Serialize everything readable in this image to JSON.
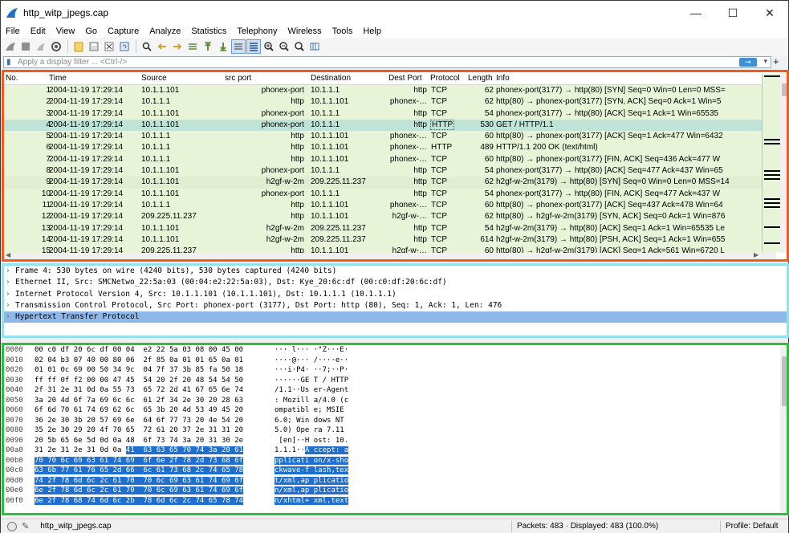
{
  "window": {
    "title": "http_witp_jpegs.cap"
  },
  "menu": [
    "File",
    "Edit",
    "View",
    "Go",
    "Capture",
    "Analyze",
    "Statistics",
    "Telephony",
    "Wireless",
    "Tools",
    "Help"
  ],
  "toolbar_icons": [
    "shark-start-icon",
    "stop-icon",
    "restart-icon",
    "options-icon",
    "open-file-icon",
    "save-file-icon",
    "close-file-icon",
    "reload-icon",
    "find-icon",
    "back-icon",
    "forward-icon",
    "go-to-packet-icon",
    "first-packet-icon",
    "last-packet-icon",
    "autoscroll-icon",
    "colorize-icon",
    "zoom-in-icon",
    "zoom-out-icon",
    "zoom-normal-icon",
    "resize-columns-icon"
  ],
  "filter": {
    "placeholder": "Apply a display filter ... <Ctrl-/>",
    "value": ""
  },
  "columns": [
    "No.",
    "Time",
    "Source",
    "src port",
    "Destination",
    "Dest Port",
    "Protocol",
    "Length",
    "Info"
  ],
  "packets": [
    {
      "no": "1",
      "time": "2004-11-19 17:29:14",
      "src": "10.1.1.101",
      "sport": "phonex-port",
      "dst": "10.1.1.1",
      "dport": "http",
      "proto": "TCP",
      "len": "62",
      "info": "phonex-port(3177) → http(80) [SYN] Seq=0 Win=0 Len=0 MSS="
    },
    {
      "no": "2",
      "time": "2004-11-19 17:29:14",
      "src": "10.1.1.1",
      "sport": "http",
      "dst": "10.1.1.101",
      "dport": "phonex-…",
      "proto": "TCP",
      "len": "62",
      "info": "http(80) → phonex-port(3177) [SYN, ACK] Seq=0 Ack=1 Win=5"
    },
    {
      "no": "3",
      "time": "2004-11-19 17:29:14",
      "src": "10.1.1.101",
      "sport": "phonex-port",
      "dst": "10.1.1.1",
      "dport": "http",
      "proto": "TCP",
      "len": "54",
      "info": "phonex-port(3177) → http(80) [ACK] Seq=1 Ack=1 Win=65535"
    },
    {
      "no": "4",
      "time": "2004-11-19 17:29:14",
      "src": "10.1.1.101",
      "sport": "phonex-port",
      "dst": "10.1.1.1",
      "dport": "http",
      "proto": "HTTP",
      "len": "530",
      "info": "GET / HTTP/1.1",
      "selected": true
    },
    {
      "no": "5",
      "time": "2004-11-19 17:29:14",
      "src": "10.1.1.1",
      "sport": "http",
      "dst": "10.1.1.101",
      "dport": "phonex-…",
      "proto": "TCP",
      "len": "60",
      "info": "http(80) → phonex-port(3177) [ACK] Seq=1 Ack=477 Win=6432"
    },
    {
      "no": "6",
      "time": "2004-11-19 17:29:14",
      "src": "10.1.1.1",
      "sport": "http",
      "dst": "10.1.1.101",
      "dport": "phonex-…",
      "proto": "HTTP",
      "len": "489",
      "info": "HTTP/1.1 200 OK  (text/html)"
    },
    {
      "no": "7",
      "time": "2004-11-19 17:29:14",
      "src": "10.1.1.1",
      "sport": "http",
      "dst": "10.1.1.101",
      "dport": "phonex-…",
      "proto": "TCP",
      "len": "60",
      "info": "http(80) → phonex-port(3177) [FIN, ACK] Seq=436 Ack=477 W"
    },
    {
      "no": "8",
      "time": "2004-11-19 17:29:14",
      "src": "10.1.1.101",
      "sport": "phonex-port",
      "dst": "10.1.1.1",
      "dport": "http",
      "proto": "TCP",
      "len": "54",
      "info": "phonex-port(3177) → http(80) [ACK] Seq=477 Ack=437 Win=65"
    },
    {
      "no": "9",
      "time": "2004-11-19 17:29:14",
      "src": "10.1.1.101",
      "sport": "h2gf-w-2m",
      "dst": "209.225.11.237",
      "dport": "http",
      "proto": "TCP",
      "len": "62",
      "info": "h2gf-w-2m(3179) → http(80) [SYN] Seq=0 Win=0 Len=0 MSS=14",
      "dim": true
    },
    {
      "no": "10",
      "time": "2004-11-19 17:29:14",
      "src": "10.1.1.101",
      "sport": "phonex-port",
      "dst": "10.1.1.1",
      "dport": "http",
      "proto": "TCP",
      "len": "54",
      "info": "phonex-port(3177) → http(80) [FIN, ACK] Seq=477 Ack=437 W"
    },
    {
      "no": "11",
      "time": "2004-11-19 17:29:14",
      "src": "10.1.1.1",
      "sport": "http",
      "dst": "10.1.1.101",
      "dport": "phonex-…",
      "proto": "TCP",
      "len": "60",
      "info": "http(80) → phonex-port(3177) [ACK] Seq=437 Ack=478 Win=64"
    },
    {
      "no": "12",
      "time": "2004-11-19 17:29:14",
      "src": "209.225.11.237",
      "sport": "http",
      "dst": "10.1.1.101",
      "dport": "h2gf-w-…",
      "proto": "TCP",
      "len": "62",
      "info": "http(80) → h2gf-w-2m(3179) [SYN, ACK] Seq=0 Ack=1 Win=876"
    },
    {
      "no": "13",
      "time": "2004-11-19 17:29:14",
      "src": "10.1.1.101",
      "sport": "h2gf-w-2m",
      "dst": "209.225.11.237",
      "dport": "http",
      "proto": "TCP",
      "len": "54",
      "info": "h2gf-w-2m(3179) → http(80) [ACK] Seq=1 Ack=1 Win=65535 Le"
    },
    {
      "no": "14",
      "time": "2004-11-19 17:29:14",
      "src": "10.1.1.101",
      "sport": "h2gf-w-2m",
      "dst": "209.225.11.237",
      "dport": "http",
      "proto": "TCP",
      "len": "614",
      "info": "h2gf-w-2m(3179) → http(80) [PSH, ACK] Seq=1 Ack=1 Win=655"
    },
    {
      "no": "15",
      "time": "2004-11-19 17:29:14",
      "src": "209.225.11.237",
      "sport": "http",
      "dst": "10.1.1.101",
      "dport": "h2gf-w-…",
      "proto": "TCP",
      "len": "60",
      "info": "http(80) → h2gf-w-2m(3179) [ACK] Seq=1 Ack=561 Win=6720 L"
    }
  ],
  "details": [
    {
      "text": "Frame 4: 530 bytes on wire (4240 bits), 530 bytes captured (4240 bits)"
    },
    {
      "text": "Ethernet II, Src: SMCNetwo_22:5a:03 (00:04:e2:22:5a:03), Dst: Kye_20:6c:df (00:c0:df:20:6c:df)"
    },
    {
      "text": "Internet Protocol Version 4, Src: 10.1.1.101 (10.1.1.101), Dst: 10.1.1.1 (10.1.1.1)"
    },
    {
      "text": "Transmission Control Protocol, Src Port: phonex-port (3177), Dst Port: http (80), Seq: 1, Ack: 1, Len: 476"
    },
    {
      "text": "Hypertext Transfer Protocol",
      "selected": true
    }
  ],
  "hex": [
    {
      "off": "0000",
      "hex": "00 c0 df 20 6c df 00 04  e2 22 5a 03 08 00 45 00",
      "ascii": "··· l··· ·\"Z···E·"
    },
    {
      "off": "0010",
      "hex": "02 04 b3 07 40 00 80 06  2f 85 0a 01 01 65 0a 01",
      "ascii": "····@··· /····e··"
    },
    {
      "off": "0020",
      "hex": "01 01 0c 69 00 50 34 9c  04 7f 37 3b 85 fa 50 18",
      "ascii": "···i·P4· ··7;··P·"
    },
    {
      "off": "0030",
      "hex": "ff ff 0f f2 00 00 47 45  54 20 2f 20 48 54 54 50",
      "ascii": "······GE T / HTTP"
    },
    {
      "off": "0040",
      "hex": "2f 31 2e 31 0d 0a 55 73  65 72 2d 41 67 65 6e 74",
      "ascii": "/1.1··Us er-Agent"
    },
    {
      "off": "0050",
      "hex": "3a 20 4d 6f 7a 69 6c 6c  61 2f 34 2e 30 20 28 63",
      "ascii": ": Mozill a/4.0 (c"
    },
    {
      "off": "0060",
      "hex": "6f 6d 70 61 74 69 62 6c  65 3b 20 4d 53 49 45 20",
      "ascii": "ompatibl e; MSIE "
    },
    {
      "off": "0070",
      "hex": "36 2e 30 3b 20 57 69 6e  64 6f 77 73 20 4e 54 20",
      "ascii": "6.0; Win dows NT "
    },
    {
      "off": "0080",
      "hex": "35 2e 30 29 20 4f 70 65  72 61 20 37 2e 31 31 20",
      "ascii": "5.0) Ope ra 7.11 "
    },
    {
      "off": "0090",
      "hex": "20 5b 65 6e 5d 0d 0a 48  6f 73 74 3a 20 31 30 2e",
      "ascii": " [en]··H ost: 10."
    },
    {
      "off": "00a0",
      "hex_plain": "31 2e 31 2e 31 0d 0a ",
      "hex_hl": "41  63 63 65 70 74 3a 20 61",
      "ascii_plain": "1.1.1··",
      "ascii_hl": "A ccept: a"
    },
    {
      "off": "00b0",
      "hex_hl": "70 70 6c 69 63 61 74 69  6f 6e 2f 78 2d 73 68 6f",
      "ascii_hl": "pplicati on/x-sho"
    },
    {
      "off": "00c0",
      "hex_hl": "63 6b 77 61 76 65 2d 66  6c 61 73 68 2c 74 65 78",
      "ascii_hl": "ckwave-f lash,tex"
    },
    {
      "off": "00d0",
      "hex_hl": "74 2f 78 6d 6c 2c 61 70  70 6c 69 63 61 74 69 6f",
      "ascii_hl": "t/xml,ap plicatio"
    },
    {
      "off": "00e0",
      "hex_hl": "6e 2f 78 6d 6c 2c 61 70  70 6c 69 63 61 74 69 6f",
      "ascii_hl": "n/xml,ap plicatio"
    },
    {
      "off": "00f0",
      "hex_hl": "6e 2f 78 68 74 6d 6c 2b  78 6d 6c 2c 74 65 78 74",
      "ascii_hl": "n/xhtml+ xml,text"
    }
  ],
  "status": {
    "file": "http_witp_jpegs.cap",
    "packets": "Packets: 483 · Displayed: 483 (100.0%)",
    "profile": "Profile: Default"
  },
  "colors": {
    "list_border": "#f05a1e",
    "details_border": "#8fe3ee",
    "bytes_border": "#27c13a",
    "row_bg": "#e7f4d7",
    "selected_row": "#bfe3d6",
    "hex_highlight": "#1f6fd0"
  }
}
